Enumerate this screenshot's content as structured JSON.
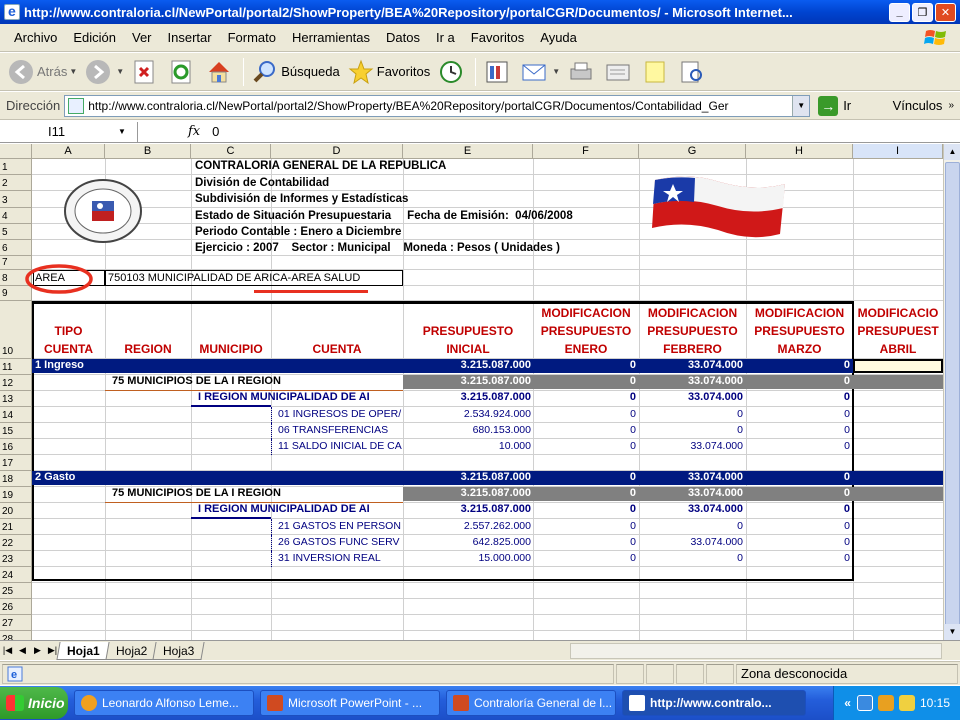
{
  "window": {
    "title": "http://www.contraloria.cl/NewPortal/portal2/ShowProperty/BEA%20Repository/portalCGR/Documentos/ - Microsoft Internet...",
    "btn_min": "_",
    "btn_max": "❐",
    "btn_close": "✕"
  },
  "menu": [
    "Archivo",
    "Edición",
    "Ver",
    "Insertar",
    "Formato",
    "Herramientas",
    "Datos",
    "Ir a",
    "Favoritos",
    "Ayuda"
  ],
  "toolbar": {
    "back": "Atrás",
    "search": "Búsqueda",
    "favorites": "Favoritos"
  },
  "address": {
    "label": "Dirección",
    "url": "http://www.contraloria.cl/NewPortal/portal2/ShowProperty/BEA%20Repository/portalCGR/Documentos/Contabilidad_Ger",
    "go": "Ir",
    "links": "Vínculos"
  },
  "formula": {
    "cell": "I11",
    "fx": "fx",
    "value": "0"
  },
  "sheet": {
    "columns": [
      "A",
      "B",
      "C",
      "D",
      "E",
      "F",
      "G",
      "H",
      "I"
    ],
    "rows": [
      "1",
      "2",
      "3",
      "4",
      "5",
      "6",
      "7",
      "8",
      "9",
      "10",
      "11",
      "12",
      "13",
      "14",
      "15",
      "16",
      "17",
      "18",
      "19",
      "20",
      "21",
      "22",
      "23",
      "24",
      "25",
      "26",
      "27",
      "28",
      "29"
    ],
    "header_lines": [
      "CONTRALORIA GENERAL DE LA REPUBLICA",
      "División de Contabilidad",
      "Subdivisión de Informes y Estadísticas",
      "Estado de Situación Presupuestaria     Fecha de Emisión:  04/06/2008",
      "Periodo Contable : Enero a Diciembre",
      "Ejercicio : 2007    Sector : Municipal    Moneda : Pesos ( Unidades )"
    ],
    "area_label": "AREA",
    "area_value": "750103 MUNICIPALIDAD DE ARICA-AREA SALUD",
    "col_titles": {
      "tipo": "TIPO CUENTA",
      "region": "REGION",
      "municipio": "MUNICIPIO",
      "cuenta": "CUENTA",
      "inicial": "PRESUPUESTO INICIAL",
      "enero": "MODIFICACION PRESUPUESTO ENERO",
      "febrero": "MODIFICACION PRESUPUESTO FEBRERO",
      "marzo": "MODIFICACION PRESUPUESTO MARZO",
      "abril": "MODIFICACIO PRESUPUEST ABRIL"
    },
    "ingreso": {
      "label": "1 Ingreso",
      "total": "3.215.087.000",
      "ene": "0",
      "feb": "33.074.000",
      "mar": "0",
      "region": "75 MUNICIPIOS DE LA I REGION",
      "region_total": "3.215.087.000",
      "region_ene": "0",
      "region_feb": "33.074.000",
      "region_mar": "0",
      "muni": "I REGION MUNICIPALIDAD DE AI",
      "muni_total": "3.215.087.000",
      "muni_ene": "0",
      "muni_feb": "33.074.000",
      "muni_mar": "0",
      "items": [
        {
          "cuenta": "01 INGRESOS DE OPER/",
          "ini": "2.534.924.000",
          "ene": "0",
          "feb": "0",
          "mar": "0"
        },
        {
          "cuenta": "06 TRANSFERENCIAS",
          "ini": "680.153.000",
          "ene": "0",
          "feb": "0",
          "mar": "0"
        },
        {
          "cuenta": "11 SALDO INICIAL DE CA",
          "ini": "10.000",
          "ene": "0",
          "feb": "33.074.000",
          "mar": "0"
        }
      ]
    },
    "gasto": {
      "label": "2 Gasto",
      "total": "3.215.087.000",
      "ene": "0",
      "feb": "33.074.000",
      "mar": "0",
      "region": "75 MUNICIPIOS DE LA I REGION",
      "region_total": "3.215.087.000",
      "region_ene": "0",
      "region_feb": "33.074.000",
      "region_mar": "0",
      "muni": "I REGION MUNICIPALIDAD DE AI",
      "muni_total": "3.215.087.000",
      "muni_ene": "0",
      "muni_feb": "33.074.000",
      "muni_mar": "0",
      "items": [
        {
          "cuenta": "21 GASTOS EN PERSON",
          "ini": "2.557.262.000",
          "ene": "0",
          "feb": "0",
          "mar": "0"
        },
        {
          "cuenta": "26 GASTOS FUNC SERV",
          "ini": "642.825.000",
          "ene": "0",
          "feb": "33.074.000",
          "mar": "0"
        },
        {
          "cuenta": "31 INVERSION REAL",
          "ini": "15.000.000",
          "ene": "0",
          "feb": "0",
          "mar": "0"
        }
      ]
    },
    "tabs": [
      "Hoja1",
      "Hoja2",
      "Hoja3"
    ]
  },
  "status": {
    "zone": "Zona desconocida"
  },
  "taskbar": {
    "start": "Inicio",
    "tasks": [
      "Leonardo Alfonso Leme...",
      "Microsoft PowerPoint - ...",
      "Contraloría General de l...",
      "http://www.contralo..."
    ],
    "chevron": "«",
    "time": "10:15"
  },
  "colors": {
    "navy": "#001a80",
    "red_header": "#c00000",
    "annotation": "#e83020"
  }
}
